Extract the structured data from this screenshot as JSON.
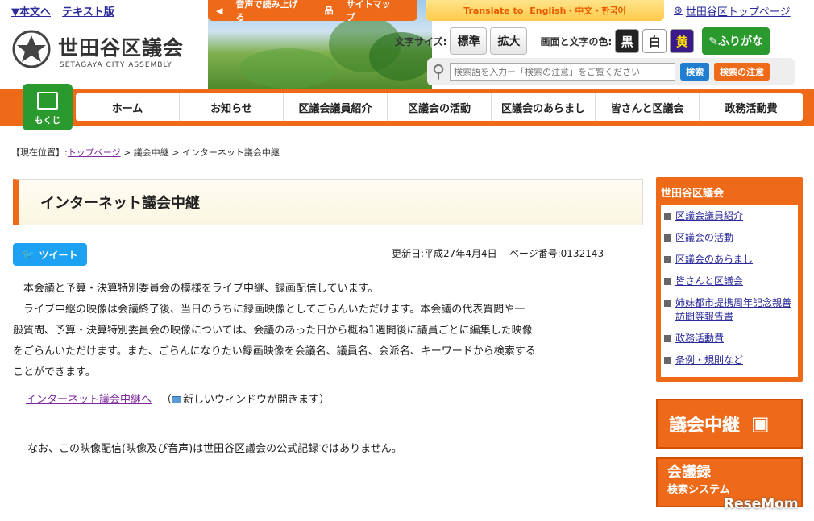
{
  "skip_links": {
    "main": "▼本文へ",
    "text": "テキスト版"
  },
  "logo": {
    "title": "世田谷区議会",
    "subtitle": "SETAGAYA CITY ASSEMBLY"
  },
  "voice_bar": {
    "read_aloud": "音声で読み上げる",
    "sitemap": "サイトマップ"
  },
  "translate": {
    "label": "Translate to",
    "langs": "English・中文・한국어"
  },
  "top_link": "世田谷区トップページ",
  "font_size": {
    "label": "文字サイズ:",
    "standard": "標準",
    "large": "拡大"
  },
  "color": {
    "label": "画面と文字の色:",
    "black": "黒",
    "white": "白",
    "yellow": "黄"
  },
  "furigana": "ふりがな",
  "search": {
    "placeholder": "検索語を入力ー「検索の注意」をご覧ください",
    "button": "検索",
    "note_button": "検索の注意"
  },
  "mokuji": "もくじ",
  "nav": [
    "ホーム",
    "お知らせ",
    "区議会議員紹介",
    "区議会の活動",
    "区議会のあらまし",
    "皆さんと区議会",
    "政務活動費"
  ],
  "breadcrumb": {
    "prefix": "【現在位置】:",
    "top": "トップページ",
    "sep1": " > ",
    "item1": "議会中継",
    "sep2": " > ",
    "item2": "インターネット議会中継"
  },
  "page_title": "インターネット議会中継",
  "tweet": "ツイート",
  "meta": {
    "updated": "更新日:平成27年4月4日",
    "page_no": "ページ番号:0132143"
  },
  "body": {
    "p1": "本会議と予算・決算特別委員会の模様をライブ中継、録画配信しています。",
    "p2a": "ライブ中継の映像は会議終了後、当日のうちに録画映像としてごらんいただけます。本会議の代表質問や一",
    "p2b": "般質問、予算・決算特別委員会の映像については、会議のあった日から概ね1週間後に議員ごとに編集した映像",
    "p2c": "をごらんいただけます。また、ごらんになりたい録画映像を会議名、議員名、会派名、キーワードから検索する",
    "p2d": "ことができます。",
    "link": "インターネット議会中継へ",
    "link_note": "新しいウィンドウが開きます",
    "note": "なお、この映像配信(映像及び音声)は世田谷区議会の公式記録ではありません。"
  },
  "sidebar": {
    "title": "世田谷区議会",
    "items": [
      "区議会議員紹介",
      "区議会の活動",
      "区議会のあらまし",
      "皆さんと区議会",
      "姉妹都市提携周年記念親善訪問等報告書",
      "政務活動費",
      "条例・規則など"
    ]
  },
  "banners": {
    "live": "議会中継",
    "minutes": "会議録",
    "minutes_sub": "検索システム"
  },
  "watermark": "ReseMom"
}
